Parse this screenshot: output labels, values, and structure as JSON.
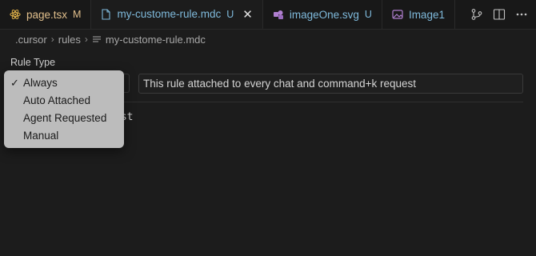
{
  "tabs": [
    {
      "label": "page.tsx",
      "status": "M",
      "icon": "react-icon",
      "active": false
    },
    {
      "label": "my-custome-rule.mdc",
      "status": "U",
      "icon": "file-icon",
      "active": true,
      "close": "✕"
    },
    {
      "label": "imageOne.svg",
      "status": "U",
      "icon": "svg-icon",
      "active": false
    },
    {
      "label": "Image1",
      "status": "",
      "icon": "image-icon",
      "active": false
    }
  ],
  "breadcrumb": {
    "items": [
      ".cursor",
      "rules",
      "my-custome-rule.mdc"
    ],
    "separator": "›"
  },
  "rule": {
    "label": "Rule Type",
    "description": "This rule attached to every chat and command+k request"
  },
  "editor": {
    "visible_text": "est"
  },
  "dropdown": {
    "selected": "Always",
    "check": "✓",
    "options": [
      "Always",
      "Auto Attached",
      "Agent Requested",
      "Manual"
    ]
  },
  "colors": {
    "modified": "#e2c08d",
    "untracked": "#7fbadc",
    "background": "#1c1c1c",
    "dropdown_bg": "#bcbcbc"
  }
}
